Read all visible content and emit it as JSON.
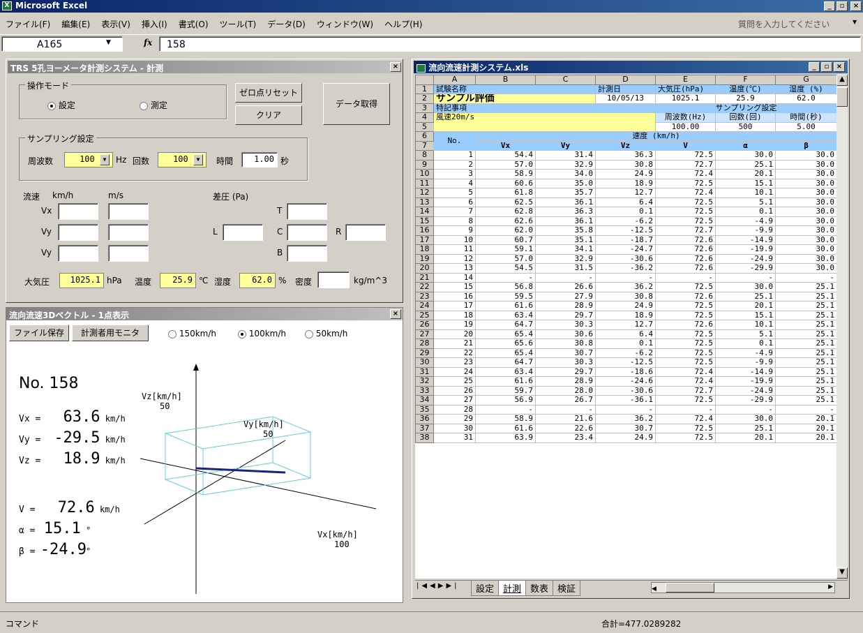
{
  "app": {
    "title": "Microsoft Excel"
  },
  "menu": {
    "items": [
      "ファイル(F)",
      "編集(E)",
      "表示(V)",
      "挿入(I)",
      "書式(O)",
      "ツール(T)",
      "データ(D)",
      "ウィンドウ(W)",
      "ヘルプ(H)"
    ],
    "help_search": "質問を入力してください"
  },
  "formula": {
    "cell": "A165",
    "fx": "fx",
    "value": "158"
  },
  "measure": {
    "title": "TRS 5孔ヨーメータ計測システム - 計測",
    "mode_group": "操作モード",
    "mode_set": "設定",
    "mode_measure": "測定",
    "zero_reset": "ゼロ点リセット",
    "clear": "クリア",
    "get_data": "データ取得",
    "sampling_group": "サンプリング設定",
    "freq_label": "周波数",
    "freq_value": "100",
    "hz": "Hz",
    "count_label": "回数",
    "count_value": "100",
    "time_label": "時間",
    "time_value": "1.00",
    "sec": "秒",
    "flow_label": "流速",
    "kmh": "km/h",
    "ms": "m/s",
    "diff_label": "差圧 (Pa)",
    "vx": "Vx",
    "vy1": "Vy",
    "vy2": "Vy",
    "t": "T",
    "l": "L",
    "c": "C",
    "r": "R",
    "b": "B",
    "pressure_label": "大気圧",
    "pressure_value": "1025.1",
    "hpa": "hPa",
    "temp_label": "温度",
    "temp_value": "25.9",
    "deg": "℃",
    "humid_label": "湿度",
    "humid_value": "62.0",
    "pct": "%",
    "density_label": "密度",
    "density_unit": "kg/m^3"
  },
  "vector": {
    "title": "流向流速3Dベクトル - 1点表示",
    "save": "ファイル保存",
    "monitor": "計測者用モニタ",
    "r150": "150km/h",
    "r100": "100km/h",
    "r50": "50km/h",
    "no": "No. 158",
    "vx_l": "Vx =",
    "vx_v": "63.6",
    "vy_l": "Vy =",
    "vy_v": "-29.5",
    "vz_l": "Vz =",
    "vz_v": "18.9",
    "v_l": "V =",
    "v_v": "72.6",
    "a_l": "α =",
    "a_v": "15.1",
    "b_l": "β =",
    "b_v": "-24.9",
    "unit": "km/h",
    "degsym": "°",
    "vz_axis": "Vz[km/h]",
    "vz_axis_v": "50",
    "vy_axis": "Vy[km/h]",
    "vy_axis_v": "50",
    "vx_axis": "Vx[km/h]",
    "vx_axis_v": "100"
  },
  "book": {
    "title": "流向流速計測システム.xls",
    "cols": [
      "A",
      "B",
      "C",
      "D",
      "E",
      "F",
      "G"
    ],
    "r1": [
      "試験名称",
      "計測日",
      "大気圧(hPa)",
      "温度(℃)",
      "湿度 (%)"
    ],
    "r2": [
      "サンプル評価",
      "10/05/13",
      "1025.1",
      "25.9",
      "62.0"
    ],
    "r3": [
      "特記事項",
      "サンプリング設定"
    ],
    "r4": [
      "風速20m/s",
      "周波数(Hz)",
      "回数(回)",
      "時間(秒)"
    ],
    "r5": [
      "100.00",
      "500",
      "5.00"
    ],
    "r6": [
      "No.",
      "速度 (km/h)"
    ],
    "r7": [
      "Vx",
      "Vy",
      "Vz",
      "V",
      "α",
      "β"
    ],
    "rows": [
      [
        "8",
        "1",
        "54.4",
        "31.4",
        "36.3",
        "72.5",
        "30.0",
        "30.0"
      ],
      [
        "9",
        "2",
        "57.0",
        "32.9",
        "30.8",
        "72.7",
        "25.1",
        "30.0"
      ],
      [
        "10",
        "3",
        "58.9",
        "34.0",
        "24.9",
        "72.4",
        "20.1",
        "30.0"
      ],
      [
        "11",
        "4",
        "60.6",
        "35.0",
        "18.9",
        "72.5",
        "15.1",
        "30.0"
      ],
      [
        "12",
        "5",
        "61.8",
        "35.7",
        "12.7",
        "72.4",
        "10.1",
        "30.0"
      ],
      [
        "13",
        "6",
        "62.5",
        "36.1",
        "6.4",
        "72.5",
        "5.1",
        "30.0"
      ],
      [
        "14",
        "7",
        "62.8",
        "36.3",
        "0.1",
        "72.5",
        "0.1",
        "30.0"
      ],
      [
        "15",
        "8",
        "62.6",
        "36.1",
        "-6.2",
        "72.5",
        "-4.9",
        "30.0"
      ],
      [
        "16",
        "9",
        "62.0",
        "35.8",
        "-12.5",
        "72.7",
        "-9.9",
        "30.0"
      ],
      [
        "17",
        "10",
        "60.7",
        "35.1",
        "-18.7",
        "72.6",
        "-14.9",
        "30.0"
      ],
      [
        "18",
        "11",
        "59.1",
        "34.1",
        "-24.7",
        "72.6",
        "-19.9",
        "30.0"
      ],
      [
        "19",
        "12",
        "57.0",
        "32.9",
        "-30.6",
        "72.6",
        "-24.9",
        "30.0"
      ],
      [
        "20",
        "13",
        "54.5",
        "31.5",
        "-36.2",
        "72.6",
        "-29.9",
        "30.0"
      ],
      [
        "21",
        "14",
        "-",
        "-",
        "-",
        "-",
        "-",
        "-"
      ],
      [
        "22",
        "15",
        "56.8",
        "26.6",
        "36.2",
        "72.5",
        "30.0",
        "25.1"
      ],
      [
        "23",
        "16",
        "59.5",
        "27.9",
        "30.8",
        "72.6",
        "25.1",
        "25.1"
      ],
      [
        "24",
        "17",
        "61.6",
        "28.9",
        "24.9",
        "72.5",
        "20.1",
        "25.1"
      ],
      [
        "25",
        "18",
        "63.4",
        "29.7",
        "18.9",
        "72.5",
        "15.1",
        "25.1"
      ],
      [
        "26",
        "19",
        "64.7",
        "30.3",
        "12.7",
        "72.6",
        "10.1",
        "25.1"
      ],
      [
        "27",
        "20",
        "65.4",
        "30.6",
        "6.4",
        "72.5",
        "5.1",
        "25.1"
      ],
      [
        "28",
        "21",
        "65.6",
        "30.8",
        "0.1",
        "72.5",
        "0.1",
        "25.1"
      ],
      [
        "29",
        "22",
        "65.4",
        "30.7",
        "-6.2",
        "72.5",
        "-4.9",
        "25.1"
      ],
      [
        "30",
        "23",
        "64.7",
        "30.3",
        "-12.5",
        "72.5",
        "-9.9",
        "25.1"
      ],
      [
        "31",
        "24",
        "63.4",
        "29.7",
        "-18.6",
        "72.4",
        "-14.9",
        "25.1"
      ],
      [
        "32",
        "25",
        "61.6",
        "28.9",
        "-24.6",
        "72.4",
        "-19.9",
        "25.1"
      ],
      [
        "33",
        "26",
        "59.7",
        "28.0",
        "-30.6",
        "72.7",
        "-24.9",
        "25.1"
      ],
      [
        "34",
        "27",
        "56.9",
        "26.7",
        "-36.1",
        "72.5",
        "-29.9",
        "25.1"
      ],
      [
        "35",
        "28",
        "-",
        "-",
        "-",
        "-",
        "-",
        "-"
      ],
      [
        "36",
        "29",
        "58.9",
        "21.6",
        "36.2",
        "72.4",
        "30.0",
        "20.1"
      ],
      [
        "37",
        "30",
        "61.6",
        "22.6",
        "30.7",
        "72.5",
        "25.1",
        "20.1"
      ],
      [
        "38",
        "31",
        "63.9",
        "23.4",
        "24.9",
        "72.5",
        "20.1",
        "20.1"
      ]
    ],
    "tabs": [
      "設定",
      "計測",
      "数表",
      "検証"
    ]
  },
  "status": {
    "left": "コマンド",
    "sum": "合計=477.0289282"
  }
}
